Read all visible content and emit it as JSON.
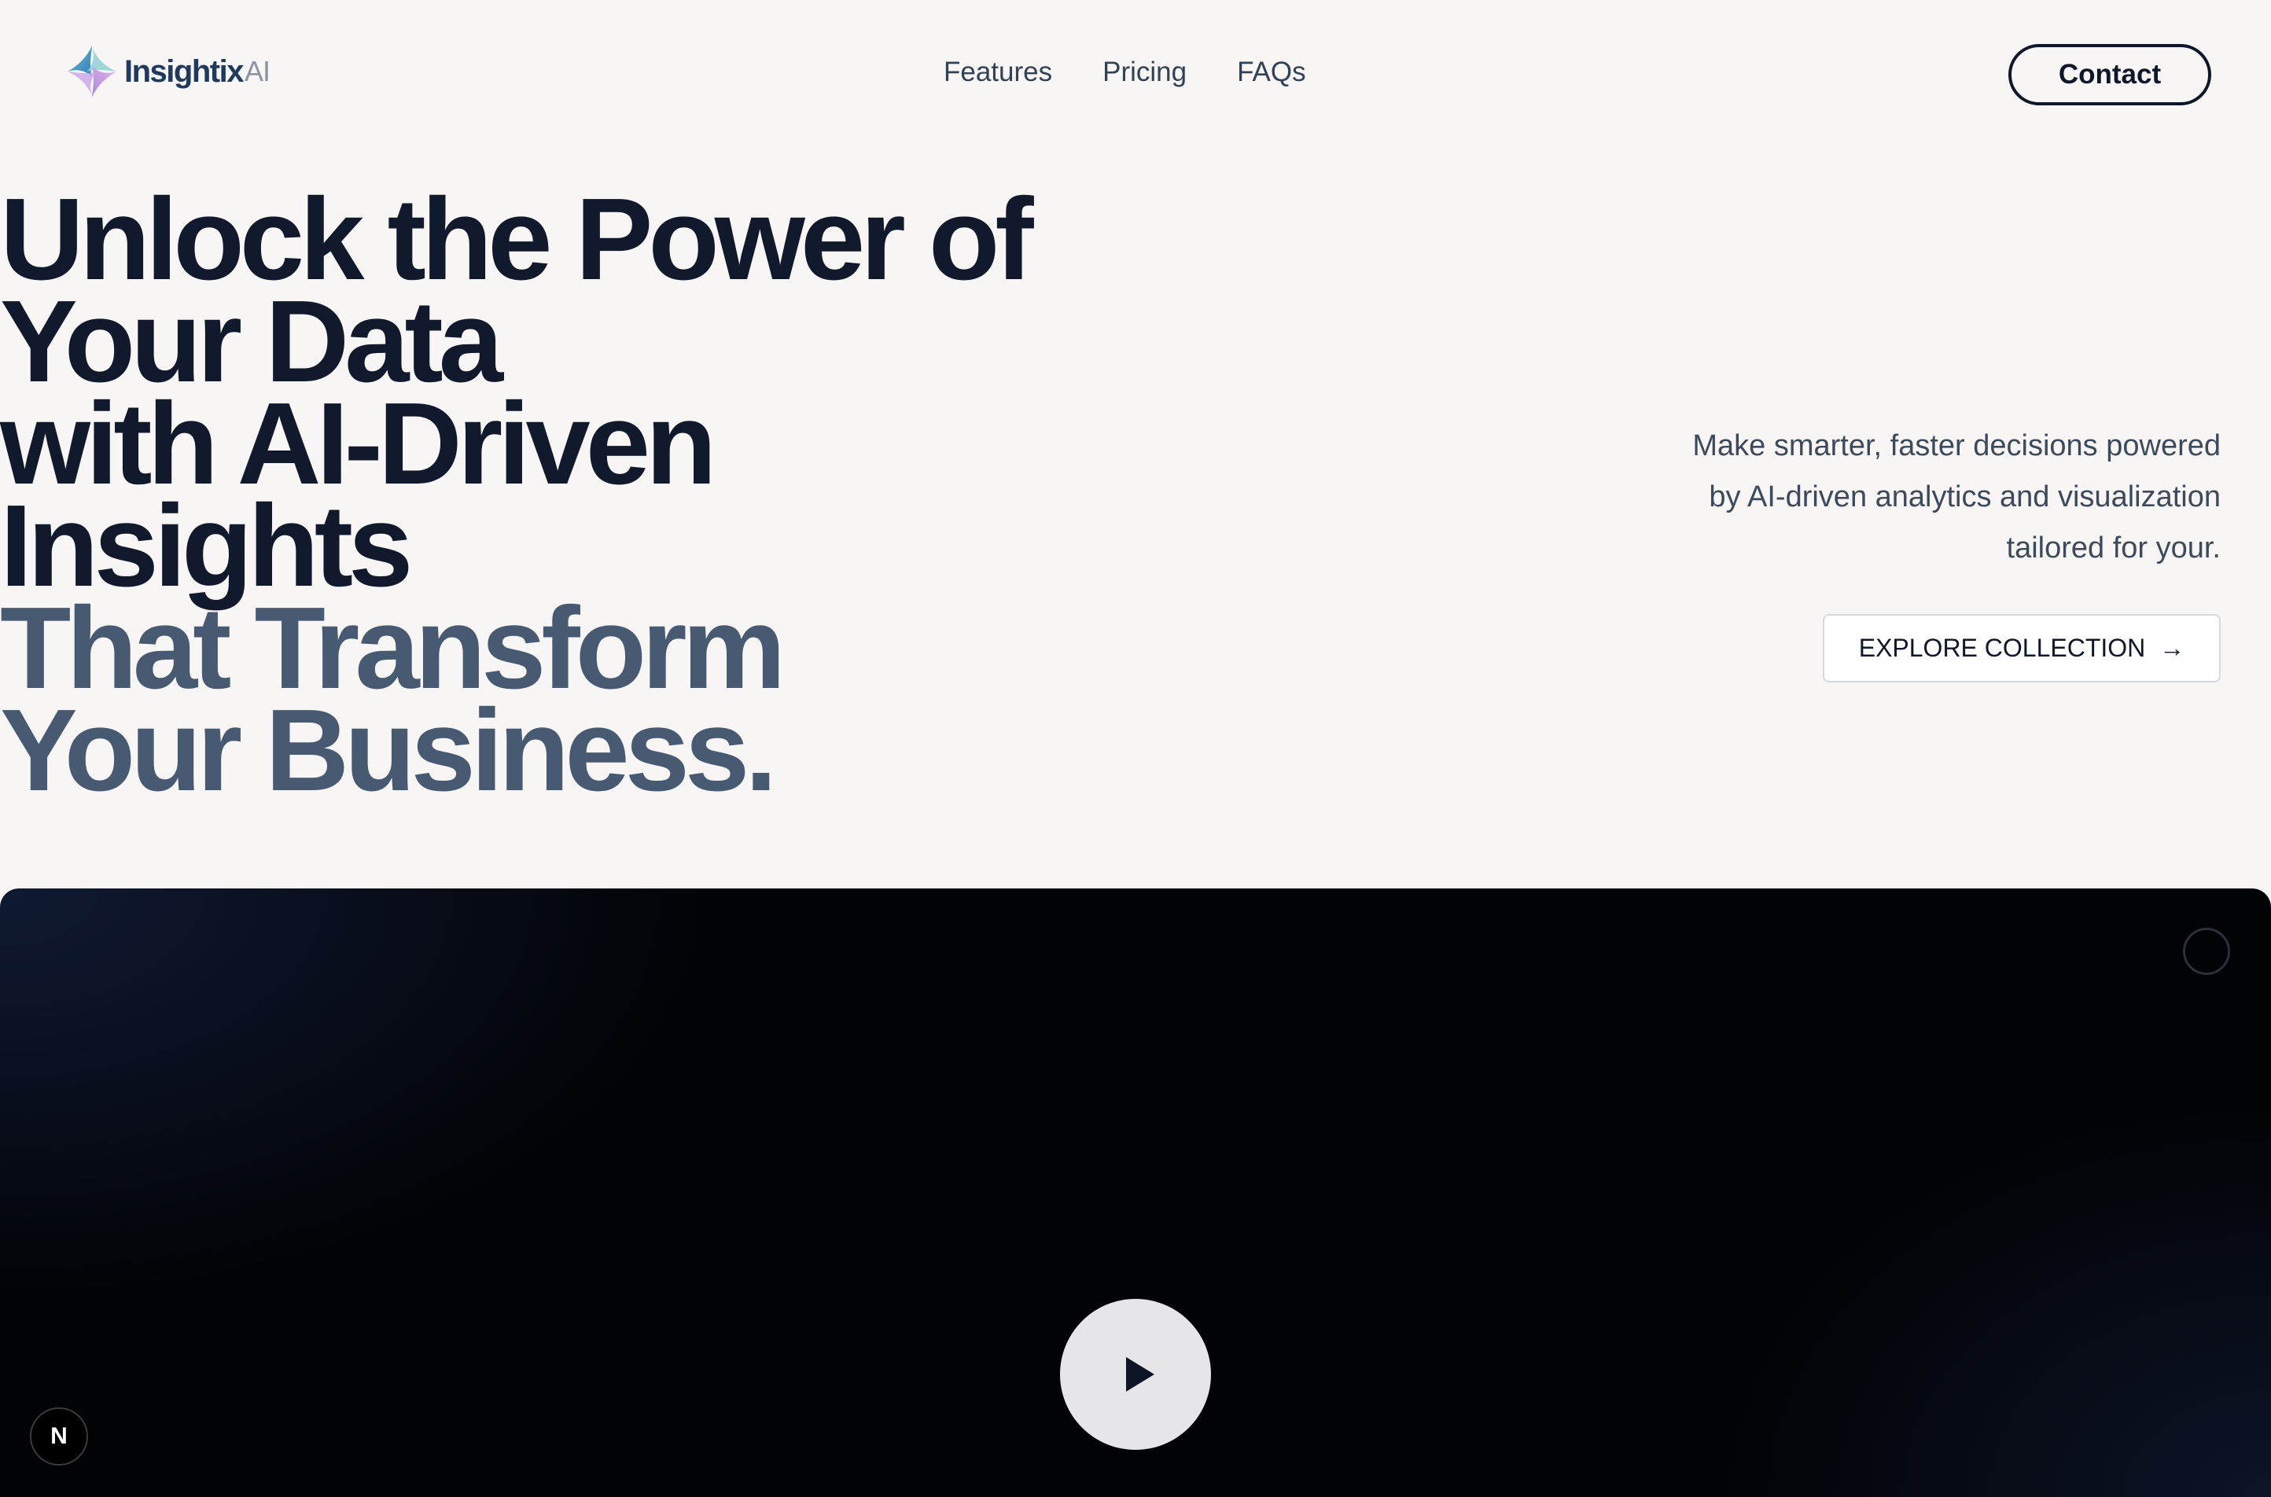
{
  "brand": {
    "name": "Insightix",
    "suffix": "AI",
    "icon": "insightix-logo-icon"
  },
  "nav": {
    "items": [
      {
        "label": "Features"
      },
      {
        "label": "Pricing"
      },
      {
        "label": "FAQs"
      }
    ],
    "contact_label": "Contact"
  },
  "hero": {
    "title_lines": [
      "Unlock the Power of",
      "Your Data",
      "with AI-Driven",
      "Insights"
    ],
    "subtitle_lines": [
      "That Transform",
      "Your Business."
    ],
    "description": "Make smarter, faster decisions powered by AI-driven analytics and visualization tailored for your.",
    "cta_label": "EXPLORE COLLECTION",
    "cta_icon": "arrow-right-icon"
  },
  "video": {
    "play_icon": "play-icon",
    "badge_label": "N"
  },
  "colors": {
    "background": "#f7f6f4",
    "heading_dark": "#111a2d",
    "heading_muted": "#485a72",
    "panel_dark": "#020306"
  }
}
